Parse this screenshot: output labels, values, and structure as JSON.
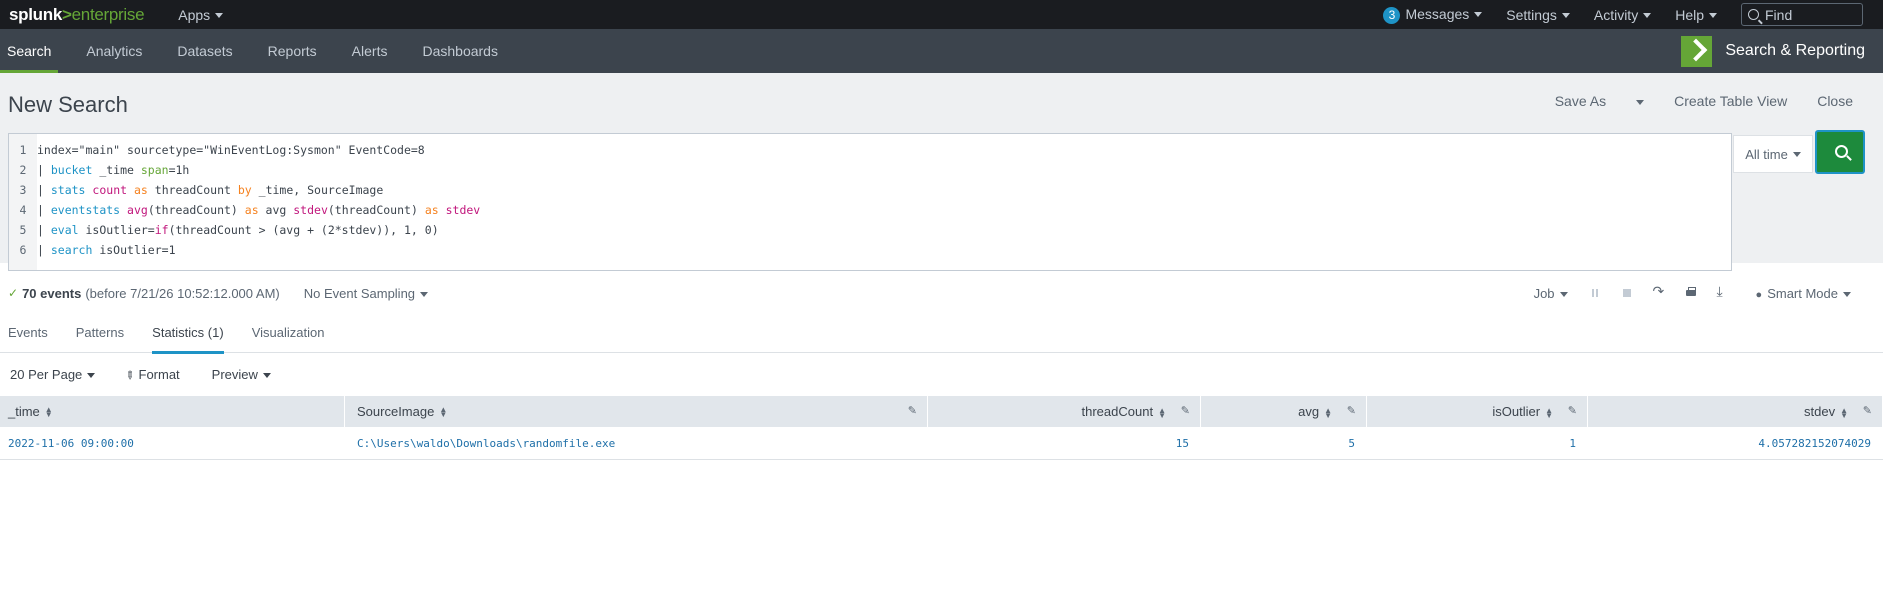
{
  "topbar": {
    "logo_splunk": "splunk",
    "logo_gt": ">",
    "logo_enterprise": "enterprise",
    "apps": "Apps",
    "messages_count": "3",
    "messages": "Messages",
    "settings": "Settings",
    "activity": "Activity",
    "help": "Help",
    "find_placeholder": "Find"
  },
  "appbar": {
    "tabs": [
      {
        "label": "Search",
        "active": true
      },
      {
        "label": "Analytics"
      },
      {
        "label": "Datasets"
      },
      {
        "label": "Reports"
      },
      {
        "label": "Alerts"
      },
      {
        "label": "Dashboards"
      }
    ],
    "app_name": "Search & Reporting"
  },
  "search": {
    "title": "New Search",
    "save_as": "Save As",
    "create_table_view": "Create Table View",
    "close": "Close",
    "time_range": "All time",
    "query_lines": [
      "index=\"main\" sourcetype=\"WinEventLog:Sysmon\" EventCode=8",
      "| bucket _time span=1h",
      "| stats count as threadCount by _time, SourceImage",
      "| eventstats avg(threadCount) as avg stdev(threadCount) as stdev",
      "| eval isOutlier=if(threadCount > (avg + (2*stdev)), 1, 0)",
      "| search isOutlier=1"
    ]
  },
  "status": {
    "events": "70 events",
    "before": "(before 7/21/26 10:52:12.000 AM)",
    "sampling": "No Event Sampling",
    "job": "Job",
    "mode": "Smart Mode"
  },
  "results_tabs": [
    "Events",
    "Patterns",
    "Statistics (1)",
    "Visualization"
  ],
  "controls": {
    "per_page": "20 Per Page",
    "format": "Format",
    "preview": "Preview"
  },
  "table": {
    "columns": [
      "_time",
      "SourceImage",
      "threadCount",
      "avg",
      "isOutlier",
      "stdev"
    ],
    "rows": [
      [
        "2022-11-06 09:00:00",
        "C:\\Users\\waldo\\Downloads\\randomfile.exe",
        "15",
        "5",
        "1",
        "4.057282152074029"
      ]
    ]
  },
  "colors": {
    "accent_green": "#65a637",
    "link_blue": "#1e93c6",
    "search_button": "#1d8a3c"
  }
}
